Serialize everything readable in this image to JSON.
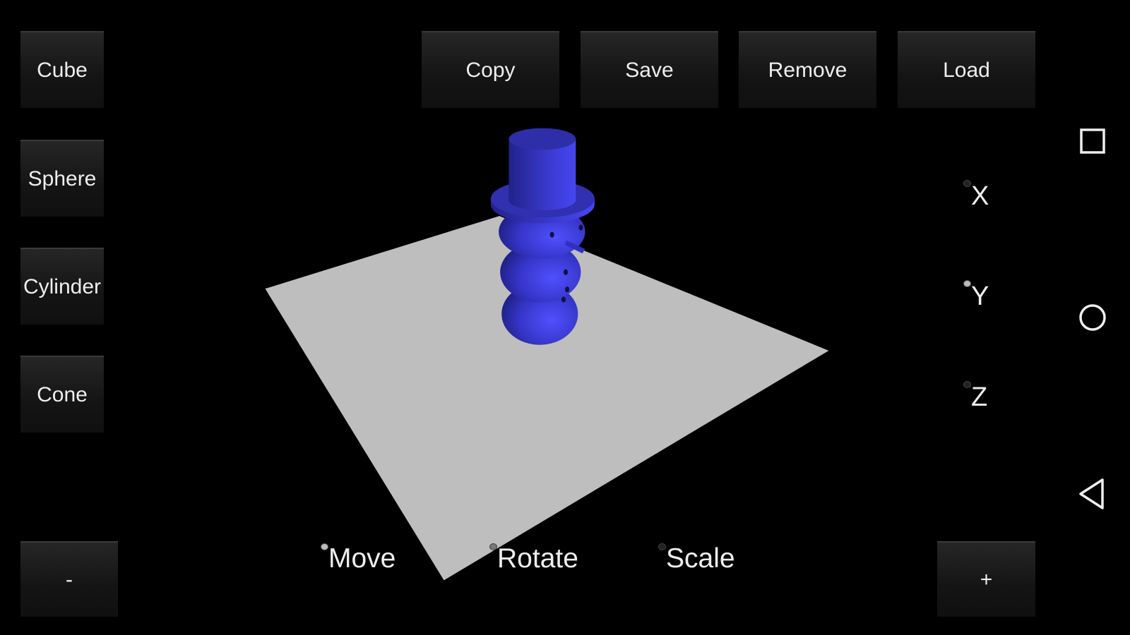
{
  "left_toolbar": {
    "items": [
      {
        "label": "Cube"
      },
      {
        "label": "Sphere"
      },
      {
        "label": "Cylinder"
      },
      {
        "label": "Cone"
      }
    ]
  },
  "top_toolbar": {
    "items": [
      {
        "label": "Copy"
      },
      {
        "label": "Save"
      },
      {
        "label": "Remove"
      },
      {
        "label": "Load"
      }
    ]
  },
  "zoom": {
    "minus_label": "-",
    "plus_label": "+"
  },
  "axes": {
    "items": [
      {
        "label": "X",
        "selected": false
      },
      {
        "label": "Y",
        "selected": true
      },
      {
        "label": "Z",
        "selected": false
      }
    ]
  },
  "modes": {
    "items": [
      {
        "label": "Move",
        "selected": true
      },
      {
        "label": "Rotate",
        "selected": false
      },
      {
        "label": "Scale",
        "selected": false
      }
    ]
  },
  "nav": {
    "icons": [
      "recents-square-icon",
      "home-circle-icon",
      "back-triangle-icon"
    ]
  },
  "colors": {
    "plane": "#bebebe",
    "snowman": "#3c3cd8",
    "background": "#000000"
  }
}
